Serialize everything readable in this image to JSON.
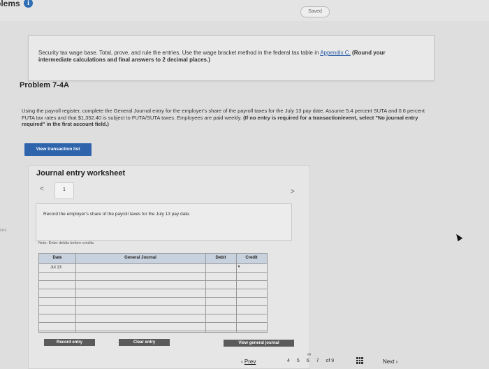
{
  "header": {
    "title": "blems",
    "info_icon": "i",
    "saved_label": "Saved"
  },
  "instructions": {
    "line1": "Security tax wage base. Total, prove, and rule the entries. Use the wage bracket method in the federal tax table in",
    "link": "Appendix C.",
    "bold": "(Round your intermediate calculations and final answers to 2 decimal places.)"
  },
  "problem": {
    "title": "Problem 7-4A",
    "paragraph": "Using the payroll register, complete the General Journal entry for the employer's share of the payroll taxes for the July 13 pay date. Assume 5.4 percent SUTA and 0.6 percent FUTA tax rates and that $1,352.40 is subject to FUTA/SUTA taxes. Employees are paid weekly.",
    "paragraph_bold": "(If no entry is required for a transaction/event, select \"No journal entry required\" in the first account field.)"
  },
  "buttons": {
    "view_transaction_list": "View transaction list",
    "record_entry": "Record entry",
    "clear_entry": "Clear entry",
    "view_general_journal": "View general journal"
  },
  "worksheet": {
    "title": "Journal entry worksheet",
    "page_number": "1",
    "nav_left": "<",
    "nav_right": ">",
    "record_text": "Record the employer's share of the payroll taxes for the July 13 pay date.",
    "note": "Note: Enter debits before credits.",
    "side_tag": "ces"
  },
  "journal": {
    "headers": [
      "Date",
      "General Journal",
      "Debit",
      "Credit"
    ],
    "first_date": "Jul 13",
    "dropdown_glyph": "▾"
  },
  "pagination": {
    "prev": "Prev",
    "pages": [
      "4",
      "5",
      "6",
      "7"
    ],
    "of_label": "of 9",
    "next": "Next",
    "link_glyph": "∞"
  }
}
